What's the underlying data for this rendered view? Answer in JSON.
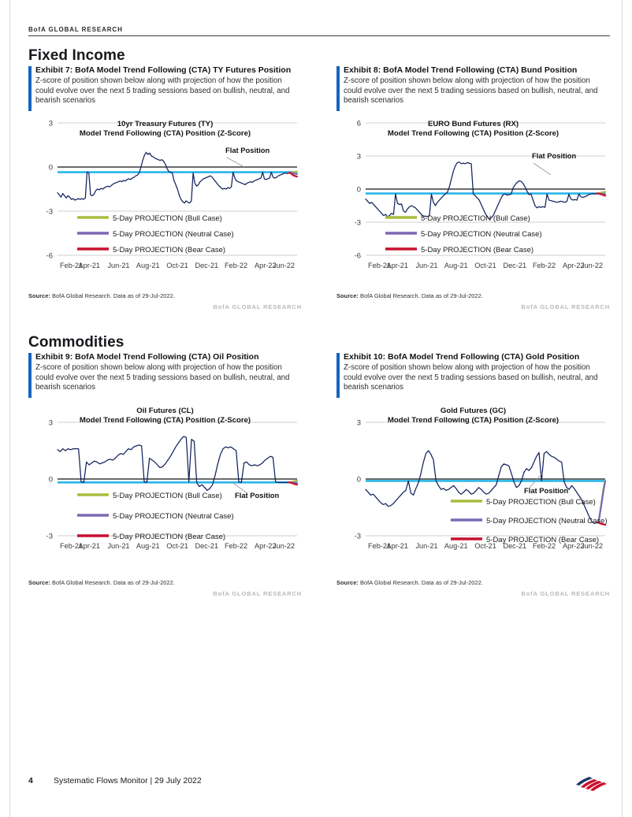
{
  "header": {
    "running_head": "BofA GLOBAL RESEARCH"
  },
  "sections": [
    {
      "id": "fixed-income",
      "title": "Fixed Income"
    },
    {
      "id": "commodities",
      "title": "Commodities"
    }
  ],
  "common": {
    "subtitle": "Z-score of position shown below along with projection of how the position could evolve over the next 5 trading sessions based on bullish, neutral, and bearish scenarios",
    "flat_position_label": "Flat Position",
    "source_label": "Source:",
    "source_text": "BofA Global Research.  Data as of 29-Jul-2022.",
    "source_right": "BofA GLOBAL RESEARCH",
    "legend": [
      {
        "label": "5-Day PROJECTION (Bull Case)",
        "color": "#a7bd3f"
      },
      {
        "label": "5-Day PROJECTION (Neutral Case)",
        "color": "#7b68b4"
      },
      {
        "label": "5-Day PROJECTION (Bear Case)",
        "color": "#c8102e"
      }
    ],
    "series_color": "#14225e",
    "zero_line_color": "#3a3a3a",
    "flat_line_color": "#29b6e8",
    "accent_color": "#1565c0"
  },
  "footer": {
    "page_number": "4",
    "doc_title": "Systematic Flows Monitor | 29 July 2022"
  },
  "exhibits": [
    {
      "id": "ex7",
      "number": "Exhibit 7:",
      "title": "Exhibit 7: BofA Model Trend Following (CTA) TY Futures Position"
    },
    {
      "id": "ex8",
      "number": "Exhibit 8:",
      "title": "Exhibit 8: BofA Model Trend Following (CTA) Bund Position"
    },
    {
      "id": "ex9",
      "number": "Exhibit 9:",
      "title": "Exhibit 9: BofA Model Trend Following (CTA) Oil Position"
    },
    {
      "id": "ex10",
      "number": "Exhibit 10:",
      "title": "Exhibit 10: BofA Model Trend Following (CTA) Gold Position"
    }
  ],
  "chart_data": [
    {
      "id": "ty",
      "type": "line",
      "title": "10yr Treasury Futures (TY)\nModel Trend Following (CTA) Position (Z-Score)",
      "title_line1": "10yr Treasury Futures (TY)",
      "title_line2": "Model Trend Following (CTA) Position (Z-Score)",
      "xlabel": "",
      "ylabel": "Z-Score",
      "ylim": [
        -6,
        3
      ],
      "yticks": [
        3,
        0,
        -3,
        -6
      ],
      "grid": true,
      "legend_position": "inside-lower-left",
      "xtick_labels": [
        "Feb-21",
        "Apr-21",
        "Jun-21",
        "Aug-21",
        "Oct-21",
        "Dec-21",
        "Feb-22",
        "Apr-22",
        "Jun-22"
      ],
      "annotations": [
        {
          "text": "Flat Position",
          "y": -0.35
        }
      ],
      "flat_position_level": -0.35,
      "series": [
        {
          "name": "TY Position (Z-Score)",
          "color": "#14225e",
          "values": [
            -1.75,
            -1.9,
            -2.05,
            -1.8,
            -1.95,
            -2.1,
            -1.95,
            -2.05,
            -2.2,
            -2.15,
            -2.25,
            -2.2,
            -2.15,
            -2.2,
            -2.15,
            -2.2,
            -2.1,
            -0.35,
            -0.4,
            -1.9,
            -1.95,
            -1.85,
            -1.6,
            -1.5,
            -1.55,
            -1.45,
            -1.5,
            -1.4,
            -1.35,
            -1.3,
            -1.35,
            -1.25,
            -1.15,
            -1.1,
            -1.05,
            -1.0,
            -0.95,
            -1.0,
            -0.9,
            -0.95,
            -0.85,
            -0.8,
            -0.85,
            -0.75,
            -0.7,
            -0.6,
            -0.55,
            -0.4,
            0.0,
            0.45,
            0.8,
            1.0,
            0.85,
            0.95,
            0.75,
            0.7,
            0.6,
            0.55,
            0.5,
            0.45,
            0.5,
            0.4,
            0.2,
            -0.1,
            -0.3,
            -0.35,
            -0.4,
            -0.9,
            -1.2,
            -1.5,
            -1.9,
            -2.2,
            -2.35,
            -2.45,
            -2.3,
            -2.4,
            -2.45,
            -2.3,
            -0.4,
            -1.1,
            -1.3,
            -1.2,
            -1.0,
            -0.9,
            -0.8,
            -0.75,
            -0.7,
            -0.65,
            -0.6,
            -0.7,
            -0.85,
            -1.0,
            -1.15,
            -1.3,
            -1.4,
            -1.5,
            -1.45,
            -1.5,
            -1.4,
            -1.45,
            -1.35,
            -0.35,
            -0.75,
            -0.95,
            -1.0,
            -1.05,
            -1.1,
            -1.15,
            -1.2,
            -1.1,
            -1.05,
            -1.0,
            -1.05,
            -0.95,
            -0.9,
            -0.85,
            -0.8,
            -0.75,
            -0.35,
            -0.8,
            -0.85,
            -0.8,
            -0.75,
            -0.35,
            -0.7,
            -0.75,
            -0.7,
            -0.6,
            -0.55,
            -0.5,
            -0.45,
            -0.4,
            -0.45,
            -0.4
          ]
        },
        {
          "name": "5-Day PROJECTION (Bull Case)",
          "color": "#a7bd3f",
          "final_values": [
            -0.4,
            -0.38,
            -0.35,
            -0.33,
            -0.3
          ]
        },
        {
          "name": "5-Day PROJECTION (Neutral Case)",
          "color": "#7b68b4",
          "final_values": [
            -0.4,
            -0.42,
            -0.44,
            -0.46,
            -0.48
          ]
        },
        {
          "name": "5-Day PROJECTION (Bear Case)",
          "color": "#c8102e",
          "final_values": [
            -0.4,
            -0.5,
            -0.58,
            -0.62,
            -0.65
          ]
        }
      ]
    },
    {
      "id": "rx",
      "type": "line",
      "title_line1": "EURO Bund Futures (RX)",
      "title_line2": "Model Trend Following (CTA) Position (Z-Score)",
      "ylim": [
        -6,
        6
      ],
      "yticks": [
        6,
        3,
        0,
        -3,
        -6
      ],
      "grid": true,
      "xtick_labels": [
        "Feb-21",
        "Apr-21",
        "Jun-21",
        "Aug-21",
        "Oct-21",
        "Dec-21",
        "Feb-22",
        "Apr-22",
        "Jun-22"
      ],
      "annotations": [
        {
          "text": "Flat Position",
          "y": -0.4
        }
      ],
      "flat_position_level": -0.4,
      "series": [
        {
          "name": "RX Position (Z-Score)",
          "color": "#14225e",
          "values": [
            -0.9,
            -1.1,
            -1.3,
            -1.2,
            -1.4,
            -1.6,
            -1.8,
            -2.0,
            -2.2,
            -2.4,
            -2.3,
            -2.5,
            -2.4,
            -2.2,
            -2.3,
            -0.45,
            -1.3,
            -1.4,
            -1.35,
            -2.0,
            -2.1,
            -1.8,
            -1.6,
            -1.5,
            -1.6,
            -1.7,
            -1.9,
            -2.1,
            -2.3,
            -2.5,
            -2.45,
            -2.5,
            -2.4,
            -0.45,
            -1.2,
            -1.5,
            -1.2,
            -1.0,
            -0.8,
            -0.6,
            -0.45,
            -0.3,
            0.2,
            0.9,
            1.6,
            2.1,
            2.4,
            2.45,
            2.3,
            2.35,
            2.3,
            2.4,
            2.35,
            2.3,
            -0.45,
            -0.6,
            -0.8,
            -1.0,
            -1.4,
            -1.8,
            -2.2,
            -2.5,
            -2.7,
            -2.6,
            -2.4,
            -2.0,
            -1.6,
            -1.2,
            -0.8,
            -0.5,
            -0.45,
            -0.55,
            -0.5,
            -0.45,
            0.1,
            0.4,
            0.6,
            0.75,
            0.7,
            0.5,
            0.2,
            -0.2,
            -0.5,
            -0.45,
            -1.0,
            -1.5,
            -1.7,
            -1.6,
            -1.65,
            -1.6,
            -1.65,
            -0.45,
            -1.0,
            -1.05,
            -1.1,
            -1.15,
            -1.2,
            -1.15,
            -1.1,
            -1.15,
            -1.2,
            -1.1,
            -0.45,
            -0.9,
            -1.0,
            -0.95,
            -1.0,
            -0.45,
            -0.7,
            -0.75,
            -0.7,
            -0.6,
            -0.5,
            -0.45,
            -0.4,
            -0.45,
            -0.4
          ]
        },
        {
          "name": "5-Day PROJECTION (Bull Case)",
          "color": "#a7bd3f",
          "final_values": [
            -0.4,
            -0.35,
            -0.3,
            -0.28,
            -0.25
          ]
        },
        {
          "name": "5-Day PROJECTION (Neutral Case)",
          "color": "#7b68b4",
          "final_values": [
            -0.4,
            -0.42,
            -0.44,
            -0.45,
            -0.46
          ]
        },
        {
          "name": "5-Day PROJECTION (Bear Case)",
          "color": "#c8102e",
          "final_values": [
            -0.4,
            -0.45,
            -0.5,
            -0.55,
            -0.6
          ]
        }
      ]
    },
    {
      "id": "cl",
      "type": "line",
      "title_line1": "Oil Futures (CL)",
      "title_line2": "Model Trend Following (CTA) Position (Z-Score)",
      "ylim": [
        -3,
        3
      ],
      "yticks": [
        3,
        0,
        -3
      ],
      "grid": true,
      "xtick_labels": [
        "Feb-21",
        "Apr-21",
        "Jun-21",
        "Aug-21",
        "Oct-21",
        "Dec-21",
        "Feb-22",
        "Apr-22",
        "Jun-22"
      ],
      "annotations": [
        {
          "text": "Flat Position",
          "y": -0.18
        }
      ],
      "flat_position_level": -0.18,
      "series": [
        {
          "name": "CL Position (Z-Score)",
          "color": "#14225e",
          "values": [
            1.55,
            1.45,
            1.6,
            1.5,
            1.6,
            1.55,
            1.6,
            1.6,
            1.6,
            -0.15,
            -0.18,
            0.9,
            0.75,
            0.85,
            0.95,
            0.9,
            0.8,
            0.85,
            0.9,
            1.0,
            1.05,
            1.0,
            1.1,
            1.25,
            1.35,
            1.3,
            1.45,
            1.6,
            1.55,
            1.7,
            1.75,
            1.8,
            1.75,
            -0.15,
            -0.18,
            1.1,
            1.0,
            0.9,
            0.75,
            0.6,
            0.65,
            0.8,
            1.0,
            1.2,
            1.45,
            1.7,
            1.9,
            2.1,
            2.25,
            2.2,
            -0.15,
            2.1,
            2.0,
            -0.2,
            -0.4,
            -0.3,
            -0.45,
            -0.6,
            -0.5,
            -0.3,
            0.2,
            0.8,
            1.3,
            1.6,
            1.7,
            1.65,
            1.7,
            1.6,
            1.5,
            -0.15,
            -0.18,
            0.85,
            0.9,
            0.75,
            0.7,
            0.75,
            0.7,
            0.75,
            0.85,
            1.0,
            1.1,
            1.2,
            1.15,
            -0.15,
            -0.18,
            -0.18,
            -0.18,
            -0.18,
            -0.18
          ]
        },
        {
          "name": "5-Day PROJECTION (Bull Case)",
          "color": "#a7bd3f",
          "final_values": [
            -0.18,
            -0.15,
            -0.12,
            -0.1,
            -0.08
          ]
        },
        {
          "name": "5-Day PROJECTION (Neutral Case)",
          "color": "#7b68b4",
          "final_values": [
            -0.18,
            -0.19,
            -0.2,
            -0.2,
            -0.21
          ]
        },
        {
          "name": "5-Day PROJECTION (Bear Case)",
          "color": "#c8102e",
          "final_values": [
            -0.18,
            -0.22,
            -0.25,
            -0.28,
            -0.3
          ]
        }
      ]
    },
    {
      "id": "gc",
      "type": "line",
      "title_line1": "Gold Futures (GC)",
      "title_line2": "Model Trend Following (CTA) Position (Z-Score)",
      "ylim": [
        -3,
        3
      ],
      "yticks": [
        3,
        0,
        -3
      ],
      "grid": true,
      "xtick_labels": [
        "Feb-21",
        "Apr-21",
        "Jun-21",
        "Aug-21",
        "Oct-21",
        "Dec-21",
        "Feb-22",
        "Apr-22",
        "Jun-22"
      ],
      "annotations": [
        {
          "text": "Flat Position",
          "y": -0.1
        }
      ],
      "flat_position_level": -0.1,
      "series": [
        {
          "name": "GC Position (Z-Score)",
          "color": "#14225e",
          "values": [
            -0.55,
            -0.7,
            -0.85,
            -0.8,
            -0.95,
            -1.1,
            -1.25,
            -1.35,
            -1.3,
            -1.45,
            -1.4,
            -1.3,
            -1.15,
            -1.0,
            -0.85,
            -0.7,
            -0.6,
            -0.1,
            -0.75,
            -0.85,
            -0.5,
            -0.2,
            0.3,
            0.9,
            1.35,
            1.5,
            1.3,
            1.0,
            -0.1,
            -0.35,
            -0.55,
            -0.5,
            -0.6,
            -0.55,
            -0.45,
            -0.35,
            -0.5,
            -0.7,
            -0.8,
            -0.7,
            -0.55,
            -0.65,
            -0.8,
            -0.75,
            -0.6,
            -0.45,
            -0.55,
            -0.7,
            -0.8,
            -0.75,
            -0.6,
            -0.45,
            -0.3,
            0.2,
            0.65,
            0.8,
            0.75,
            0.7,
            0.3,
            -0.15,
            -0.45,
            -0.35,
            -0.1,
            0.35,
            0.55,
            0.45,
            0.6,
            0.9,
            1.2,
            1.4,
            -0.1,
            1.35,
            1.45,
            1.3,
            1.2,
            1.15,
            1.05,
            0.95,
            0.9,
            -0.15,
            -0.45,
            -0.55,
            -0.35,
            -0.5,
            -0.7,
            -0.9,
            -1.1,
            -1.4,
            -1.7,
            -2.0,
            -2.25,
            -2.35,
            -2.3
          ]
        },
        {
          "name": "5-Day PROJECTION (Bull Case)",
          "color": "#a7bd3f",
          "final_values": [
            -2.3,
            -1.7,
            -1.1,
            -0.5,
            -0.1
          ]
        },
        {
          "name": "5-Day PROJECTION (Neutral Case)",
          "color": "#7b68b4",
          "final_values": [
            -2.3,
            -1.75,
            -1.2,
            -0.6,
            -0.12
          ]
        },
        {
          "name": "5-Day PROJECTION (Bear Case)",
          "color": "#c8102e",
          "final_values": [
            -2.3,
            -2.35,
            -2.38,
            -2.4,
            -2.42
          ]
        }
      ]
    }
  ]
}
